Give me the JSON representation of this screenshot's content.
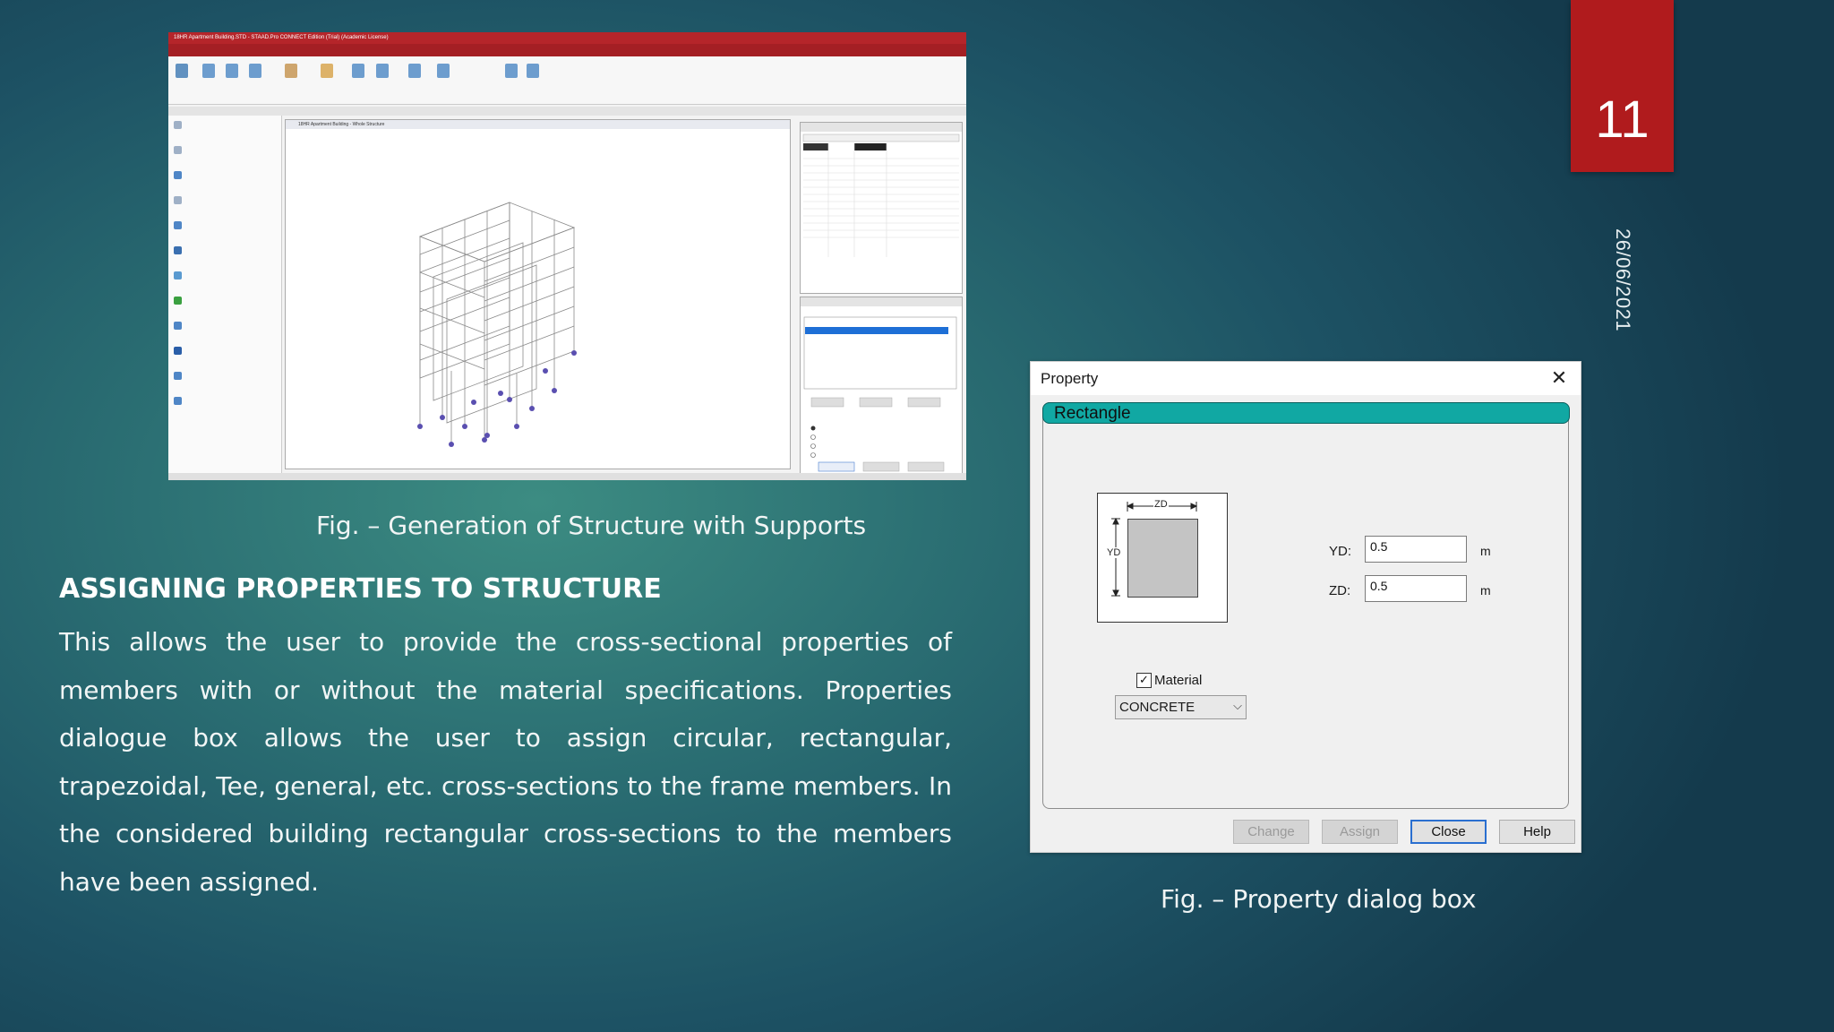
{
  "slide": {
    "number": "11",
    "date": "26/06/2021"
  },
  "figure1": {
    "caption": "Fig. – Generation of Structure with Supports",
    "window_title": "18HR Apartment Building.STD - STAAD.Pro CONNECT Edition (Trial) (Academic License)",
    "view_title": "18HR Apartment Building - Whole Structure"
  },
  "section": {
    "heading": "ASSIGNING PROPERTIES TO STRUCTURE",
    "body": "This allows the user to provide the cross-sectional properties of members with or without the material specifications. Properties dialogue box allows the user to assign circular, rectangular, trapezoidal, Tee, general, etc. cross-sections to the frame members. In the considered building rectangular cross-sections to the members have been assigned."
  },
  "dialog": {
    "title": "Property",
    "close_glyph": "✕",
    "shape": "Rectangle",
    "diagram": {
      "zd_label": "ZD",
      "yd_label": "YD"
    },
    "fields": {
      "yd": {
        "label": "YD:",
        "value": "0.5",
        "unit": "m"
      },
      "zd": {
        "label": "ZD:",
        "value": "0.5",
        "unit": "m"
      }
    },
    "material": {
      "label": "Material",
      "checked": true,
      "check_glyph": "✓",
      "selected": "CONCRETE",
      "chevron": "⌵"
    },
    "buttons": {
      "change": "Change",
      "assign": "Assign",
      "close": "Close",
      "help": "Help"
    },
    "colors": {
      "shape_bar": "#11a8a3",
      "focus_border": "#2a6fd0"
    }
  },
  "figure2": {
    "caption": "Fig. – Property dialog box"
  },
  "colors": {
    "slide_number_bg": "#b01b1d",
    "background_center": "#3c8c82",
    "background_edge": "#143a4c"
  }
}
